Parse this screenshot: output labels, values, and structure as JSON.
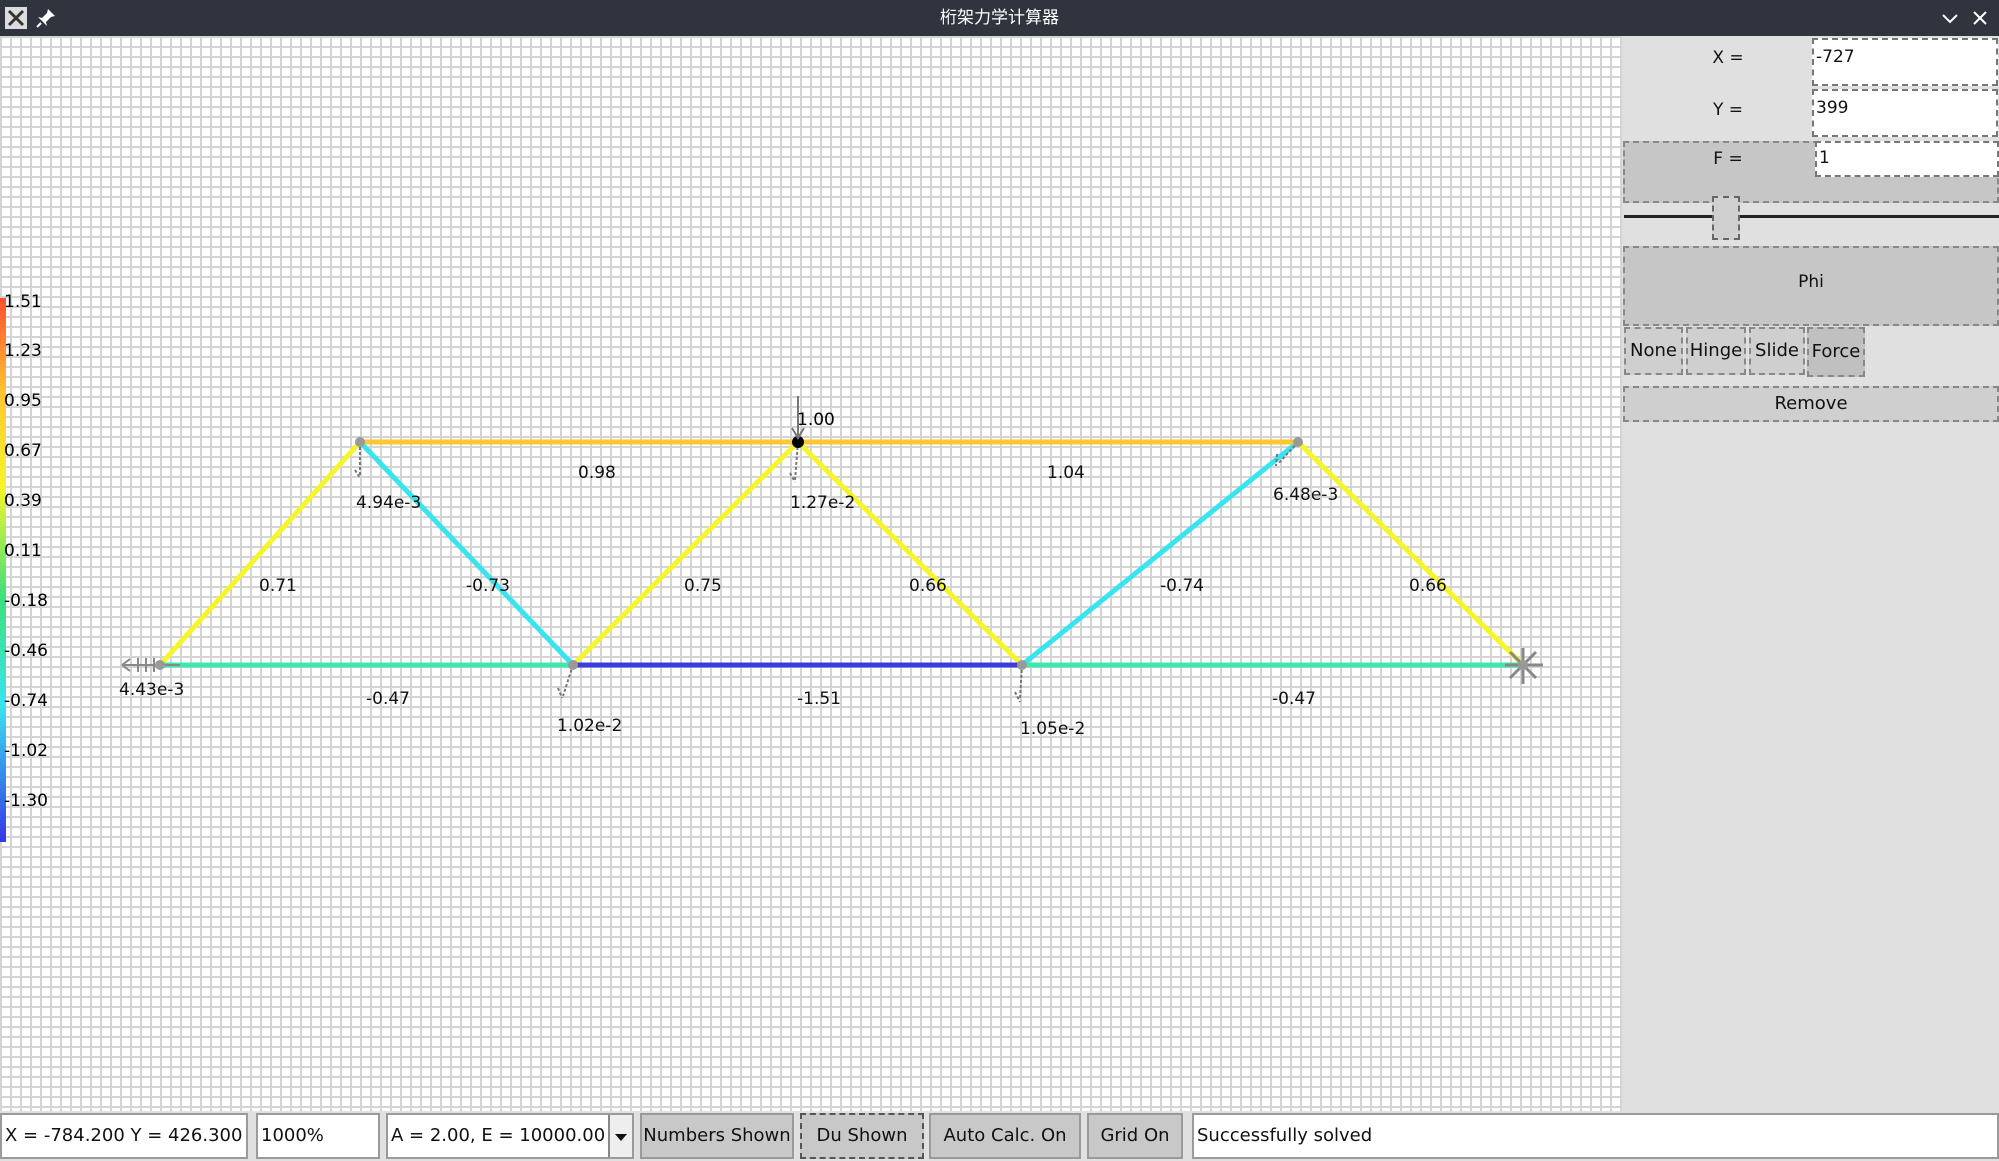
{
  "window": {
    "title": "桁架力学计算器",
    "app_icon": "x-app-icon",
    "pin_icon": "pin-icon",
    "min_icon": "chevron-down-icon",
    "close_icon": "close-icon"
  },
  "colorbar": {
    "labels": [
      "1.51",
      "1.23",
      "0.95",
      "0.67",
      "0.39",
      "0.11",
      "-0.18",
      "-0.46",
      "-0.74",
      "-1.02",
      "-1.30"
    ],
    "colors": {
      "max": "#ff4d30",
      "high": "#ffc830",
      "mid_high": "#f5f52a",
      "mid": "#3de07a",
      "mid_low": "#38e4f0",
      "low": "#3535e8"
    }
  },
  "truss": {
    "members": [
      {
        "force": "0.71",
        "color": "#f5f52a"
      },
      {
        "force": "-0.73",
        "color": "#38e4f0"
      },
      {
        "force": "0.75",
        "color": "#f5f52a"
      },
      {
        "force": "0.66",
        "color": "#f5f52a"
      },
      {
        "force": "-0.74",
        "color": "#38e4f0"
      },
      {
        "force": "0.66",
        "color": "#f5f52a"
      },
      {
        "force": "0.98",
        "color": "#ffc830"
      },
      {
        "force": "1.04",
        "color": "#ffc830"
      },
      {
        "force": "-0.47",
        "color": "#3de8b0"
      },
      {
        "force": "-1.51",
        "color": "#3b3be0"
      },
      {
        "force": "-0.47",
        "color": "#3de8b0"
      }
    ],
    "node_displacements": [
      "4.43e-3",
      "4.94e-3",
      "1.27e-2",
      "6.48e-3",
      "1.02e-2",
      "1.05e-2"
    ],
    "applied_force_label": "1.00"
  },
  "panel": {
    "x_label": "X =",
    "x_value": "-727",
    "y_label": "Y =",
    "y_value": "399",
    "f_label": "F =",
    "f_value": "1",
    "phi_label": "Phi",
    "support_buttons": [
      "None",
      "Hinge",
      "Slide",
      "Force"
    ],
    "selected_support": "Force",
    "remove_label": "Remove"
  },
  "statusbar": {
    "coords": "X = -784.200 Y = 426.300",
    "zoom": "1000%",
    "material": "A = 2.00, E = 10000.00",
    "numbers_btn": "Numbers Shown",
    "du_btn": "Du Shown",
    "autocalc_btn": "Auto Calc. On",
    "grid_btn": "Grid On",
    "message": "Successfully solved"
  }
}
